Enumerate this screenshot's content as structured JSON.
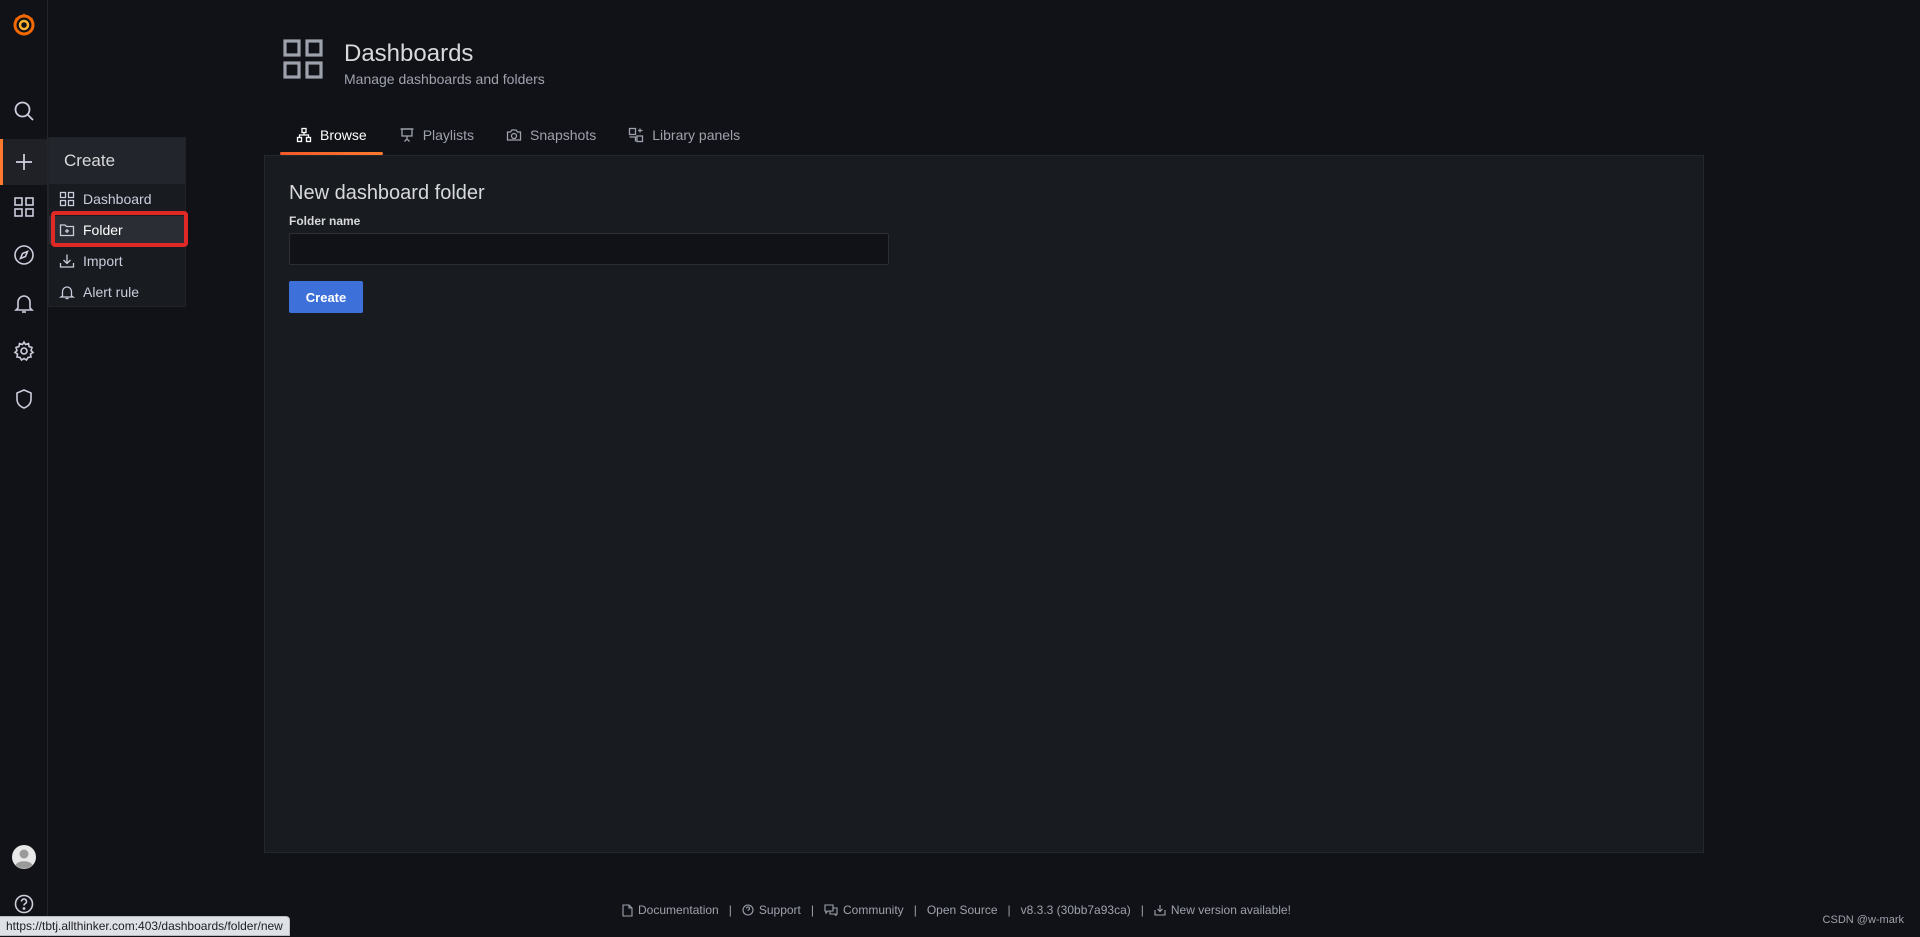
{
  "sidebar": {
    "icons": [
      "grafana-logo-icon",
      "search-icon",
      "plus-icon",
      "dashboards-icon",
      "explore-compass-icon",
      "alerting-bell-icon",
      "configuration-gear-icon",
      "server-admin-shield-icon",
      "user-avatar-icon",
      "help-icon"
    ]
  },
  "create_menu": {
    "title": "Create",
    "items": [
      {
        "label": "Dashboard",
        "icon": "apps-icon"
      },
      {
        "label": "Folder",
        "icon": "folder-plus-icon"
      },
      {
        "label": "Import",
        "icon": "import-icon"
      },
      {
        "label": "Alert rule",
        "icon": "bell-icon"
      }
    ]
  },
  "header": {
    "title": "Dashboards",
    "subtitle": "Manage dashboards and folders"
  },
  "tabs": [
    {
      "label": "Browse",
      "icon": "sitemap-icon",
      "active": true
    },
    {
      "label": "Playlists",
      "icon": "presentation-icon",
      "active": false
    },
    {
      "label": "Snapshots",
      "icon": "camera-icon",
      "active": false
    },
    {
      "label": "Library panels",
      "icon": "library-panel-icon",
      "active": false
    }
  ],
  "form": {
    "title": "New dashboard folder",
    "folder_label": "Folder name",
    "folder_value": "",
    "create_button": "Create"
  },
  "footer": {
    "documentation": "Documentation",
    "support": "Support",
    "community": "Community",
    "open_source": "Open Source",
    "version": "v8.3.3 (30bb7a93ca)",
    "new_version": "New version available!",
    "separator": "|"
  },
  "status_url": "https://tbtj.allthinker.com:403/dashboards/folder/new",
  "watermark": "CSDN @w-mark",
  "colors": {
    "accent": "#ff7a2e",
    "primary_button": "#3d71d9",
    "highlight_box": "#e02826"
  }
}
